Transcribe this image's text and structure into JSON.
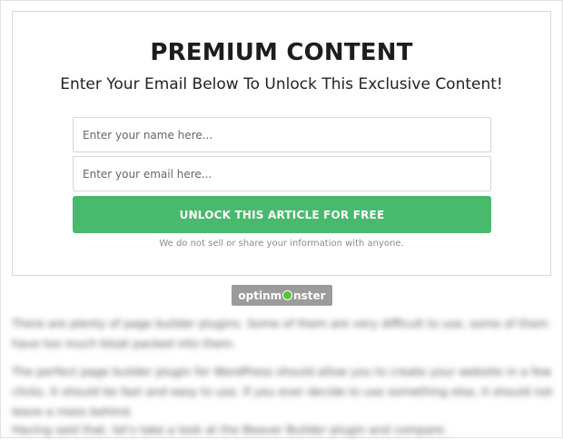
{
  "popup": {
    "title": "PREMIUM CONTENT",
    "subtitle": "Enter Your Email Below To Unlock This Exclusive Content!",
    "name_placeholder": "Enter your name here...",
    "email_placeholder": "Enter your email here...",
    "button_label": "UNLOCK THIS ARTICLE FOR FREE",
    "privacy_note": "We do not sell or share your information with anyone."
  },
  "badge": {
    "brand_prefix": "optinm",
    "brand_suffix": "nster",
    "icon": "monster-o-icon"
  },
  "blurred_article": {
    "p1": "There are plenty of page builder plugins. Some of them are very difficult to use, some of them have too much bloat packed into them.",
    "p2": "The perfect page builder plugin for WordPress should allow you to create your website in a few clicks. It should be fast and easy to use. If you ever decide to use something else, it should not leave a mess behind.",
    "p3": "Having said that, let's take a look at the Beaver Builder plugin and compare."
  },
  "colors": {
    "button_green": "#48b96d",
    "badge_gray": "#9b9b9b"
  }
}
